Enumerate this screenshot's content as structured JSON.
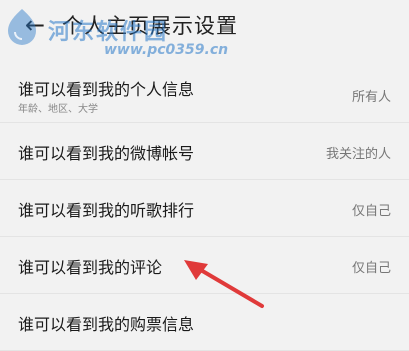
{
  "header": {
    "back_icon": "back-arrow-icon",
    "title": "个人主页展示设置"
  },
  "watermark": {
    "cn_text": "河东软件园",
    "url": "www.pc0359.cn"
  },
  "settings": {
    "items": [
      {
        "label": "谁可以看到我的个人信息",
        "sublabel": "年龄、地区、大学",
        "value": "所有人"
      },
      {
        "label": "谁可以看到我的微博帐号",
        "value": "我关注的人"
      },
      {
        "label": "谁可以看到我的听歌排行",
        "value": "仅自己"
      },
      {
        "label": "谁可以看到我的评论",
        "value": "仅自己"
      },
      {
        "label": "谁可以看到我的购票信息",
        "value": ""
      }
    ]
  },
  "annotation": {
    "arrow_color": "#e03a3a"
  }
}
